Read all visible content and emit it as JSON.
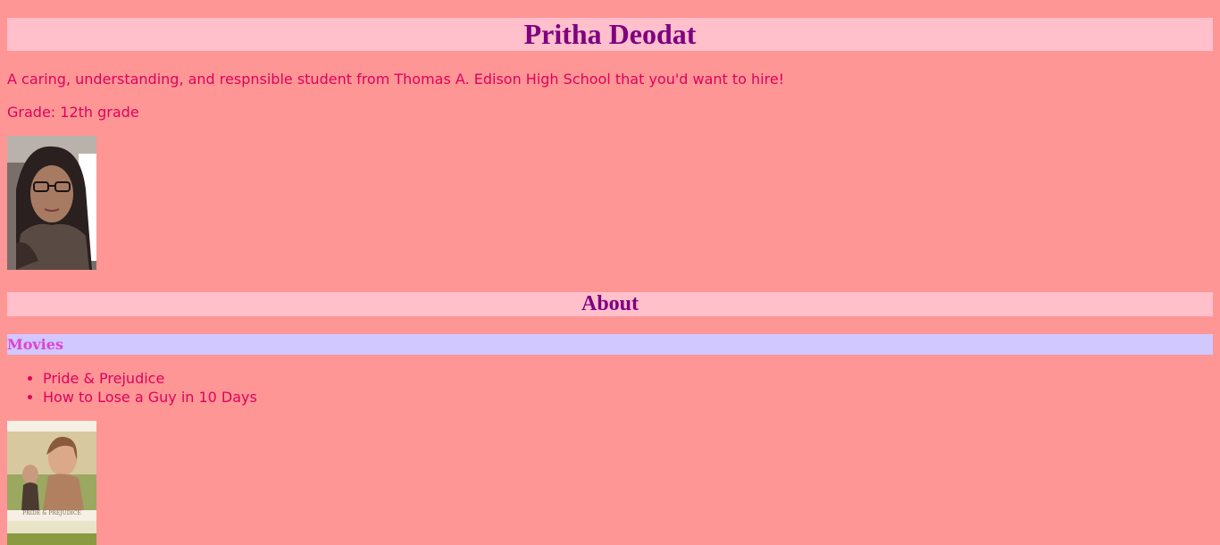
{
  "header": {
    "title": "Pritha Deodat"
  },
  "profile": {
    "intro": "A caring, understanding, and respnsible student from Thomas A. Edison High School that you'd want to hire!",
    "grade": "Grade: 12th grade",
    "photo_icon": "portrait-photo"
  },
  "about": {
    "title": "About",
    "movies": {
      "title": "Movies",
      "items": [
        "Pride & Prejudice",
        "How to Lose a Guy in 10 Days"
      ],
      "poster_caption": "PRIDE & PREJUDICE"
    }
  },
  "colors": {
    "background": "#ff9696",
    "header_band": "#ffc0cb",
    "heading_text": "#800080",
    "body_text": "#e0005a",
    "movies_band": "#d0c8ff",
    "movies_text": "#e040d0"
  }
}
